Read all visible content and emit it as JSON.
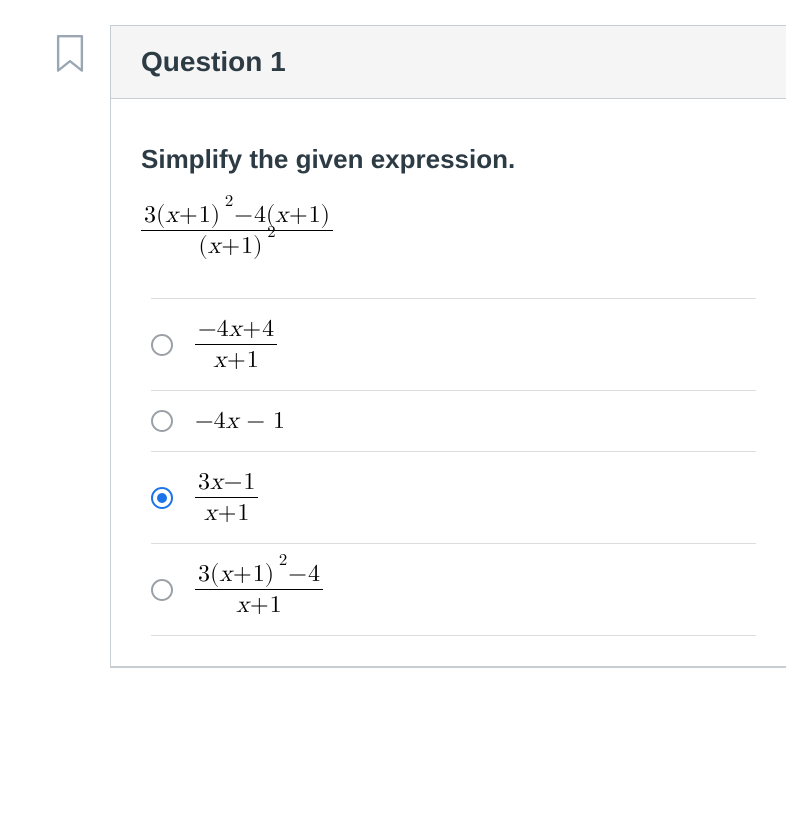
{
  "header": {
    "title": "Question 1"
  },
  "prompt": "Simplify the given expression.",
  "expression": {
    "numerator_html": "3(<span class='math-var'>x</span><span class='op'>+</span>1<span class='supseg'>)<span class='sup'>2</span></span><span class='op'>−</span>4(<span class='math-var'>x</span><span class='op'>+</span>1)",
    "denominator_html": "(<span class='math-var'>x</span><span class='op'>+</span>1<span class='supseg'>)<span class='sup'>2</span></span>"
  },
  "options": [
    {
      "id": "opt-a",
      "selected": false,
      "type": "frac",
      "numerator_html": "−4<span class='math-var'>x</span><span class='op'>+</span>4",
      "denominator_html": "<span class='math-var'>x</span><span class='op'>+</span>1"
    },
    {
      "id": "opt-b",
      "selected": false,
      "type": "inline",
      "inline_html": "−4<span class='math-var'>x</span> − 1"
    },
    {
      "id": "opt-c",
      "selected": true,
      "type": "frac",
      "numerator_html": "3<span class='math-var'>x</span><span class='op'>−</span>1",
      "denominator_html": "<span class='math-var'>x</span><span class='op'>+</span>1"
    },
    {
      "id": "opt-d",
      "selected": false,
      "type": "frac",
      "numerator_html": "3(<span class='math-var'>x</span><span class='op'>+</span>1<span class='supseg'>)<span class='sup'>2</span></span><span class='op'>−</span>4",
      "denominator_html": "<span class='math-var'>x</span><span class='op'>+</span>1"
    }
  ]
}
